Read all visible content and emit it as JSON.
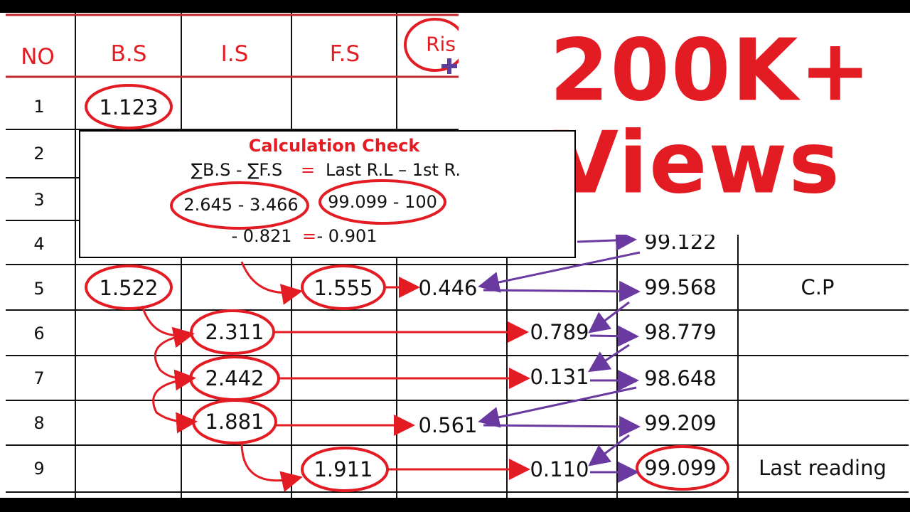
{
  "headers": {
    "no": "NO",
    "bs": "B.S",
    "is": "I.S",
    "fs": "F.S",
    "rise": "Ris"
  },
  "rows": [
    {
      "no": "1",
      "bs": "1.123"
    },
    {
      "no": "2"
    },
    {
      "no": "3"
    },
    {
      "no": "4",
      "rl": "99.122"
    },
    {
      "no": "5",
      "bs": "1.522",
      "fs": "1.555",
      "rise": "0.446",
      "rl": "99.568",
      "remarks": "C.P"
    },
    {
      "no": "6",
      "is": "2.311",
      "fall": "0.789",
      "rl": "98.779"
    },
    {
      "no": "7",
      "is": "2.442",
      "fall": "0.131",
      "rl": "98.648"
    },
    {
      "no": "8",
      "is": "1.881",
      "rise": "0.561",
      "rl": "99.209"
    },
    {
      "no": "9",
      "fs": "1.911",
      "fall": "0.110",
      "rl": "99.099",
      "remarks": "Last reading"
    }
  ],
  "calculation_check": {
    "title": "Calculation Check",
    "formula_left": "∑B.S - ∑F.S",
    "equals": "=",
    "formula_right": "Last R.L – 1st R.",
    "values_left": "2.645 - 3.466",
    "values_right": "99.099 - 100",
    "result_left": "- 0.821",
    "result_right": "- 0.901"
  },
  "banner": {
    "line1": "200K+",
    "line2": "Views"
  },
  "colors": {
    "red": "#e31b23",
    "purple": "#6a3aa0",
    "black": "#000000"
  }
}
